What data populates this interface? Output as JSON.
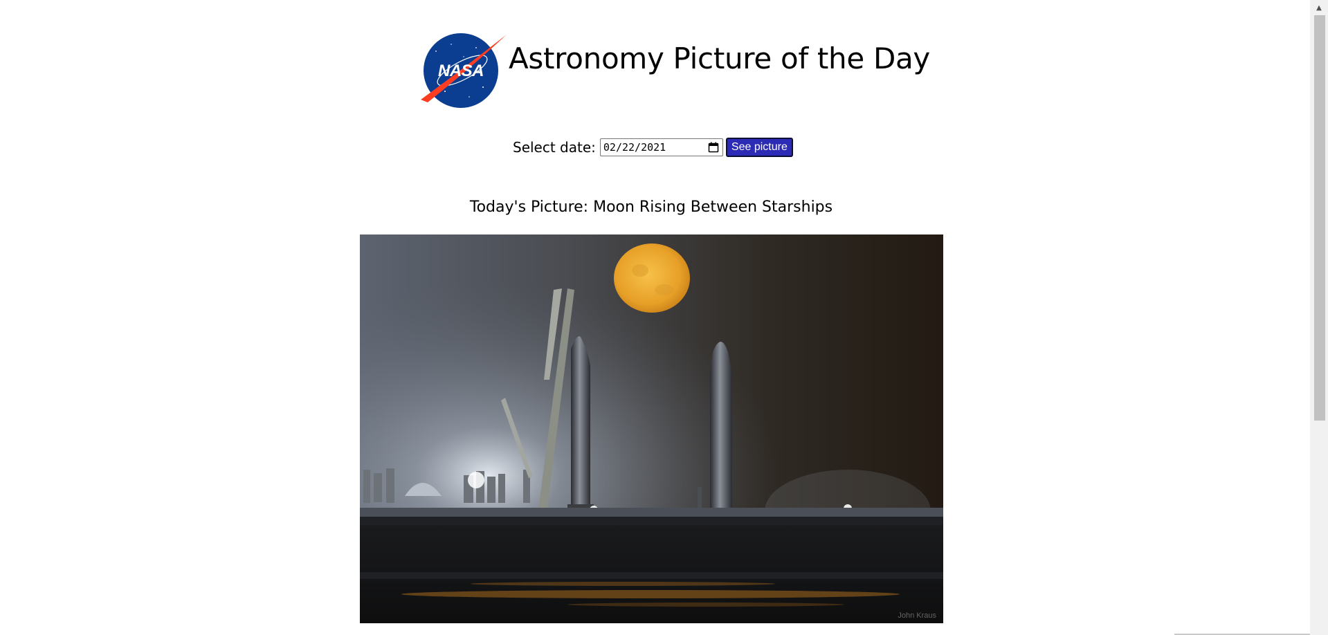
{
  "header": {
    "logo_alt": "NASA",
    "title": "Astronomy Picture of the Day"
  },
  "date_picker": {
    "label": "Select date:",
    "value": "02/22/2021",
    "button_label": "See picture"
  },
  "picture": {
    "heading": "Today's Picture: Moon Rising Between Starships",
    "credit": "John Kraus"
  },
  "icons": {
    "calendar": "calendar-icon",
    "scroll_up": "chevron-up-icon"
  },
  "colors": {
    "button_bg": "#2b2bb5",
    "nasa_blue": "#0b3d91",
    "nasa_red": "#fc3d21"
  }
}
